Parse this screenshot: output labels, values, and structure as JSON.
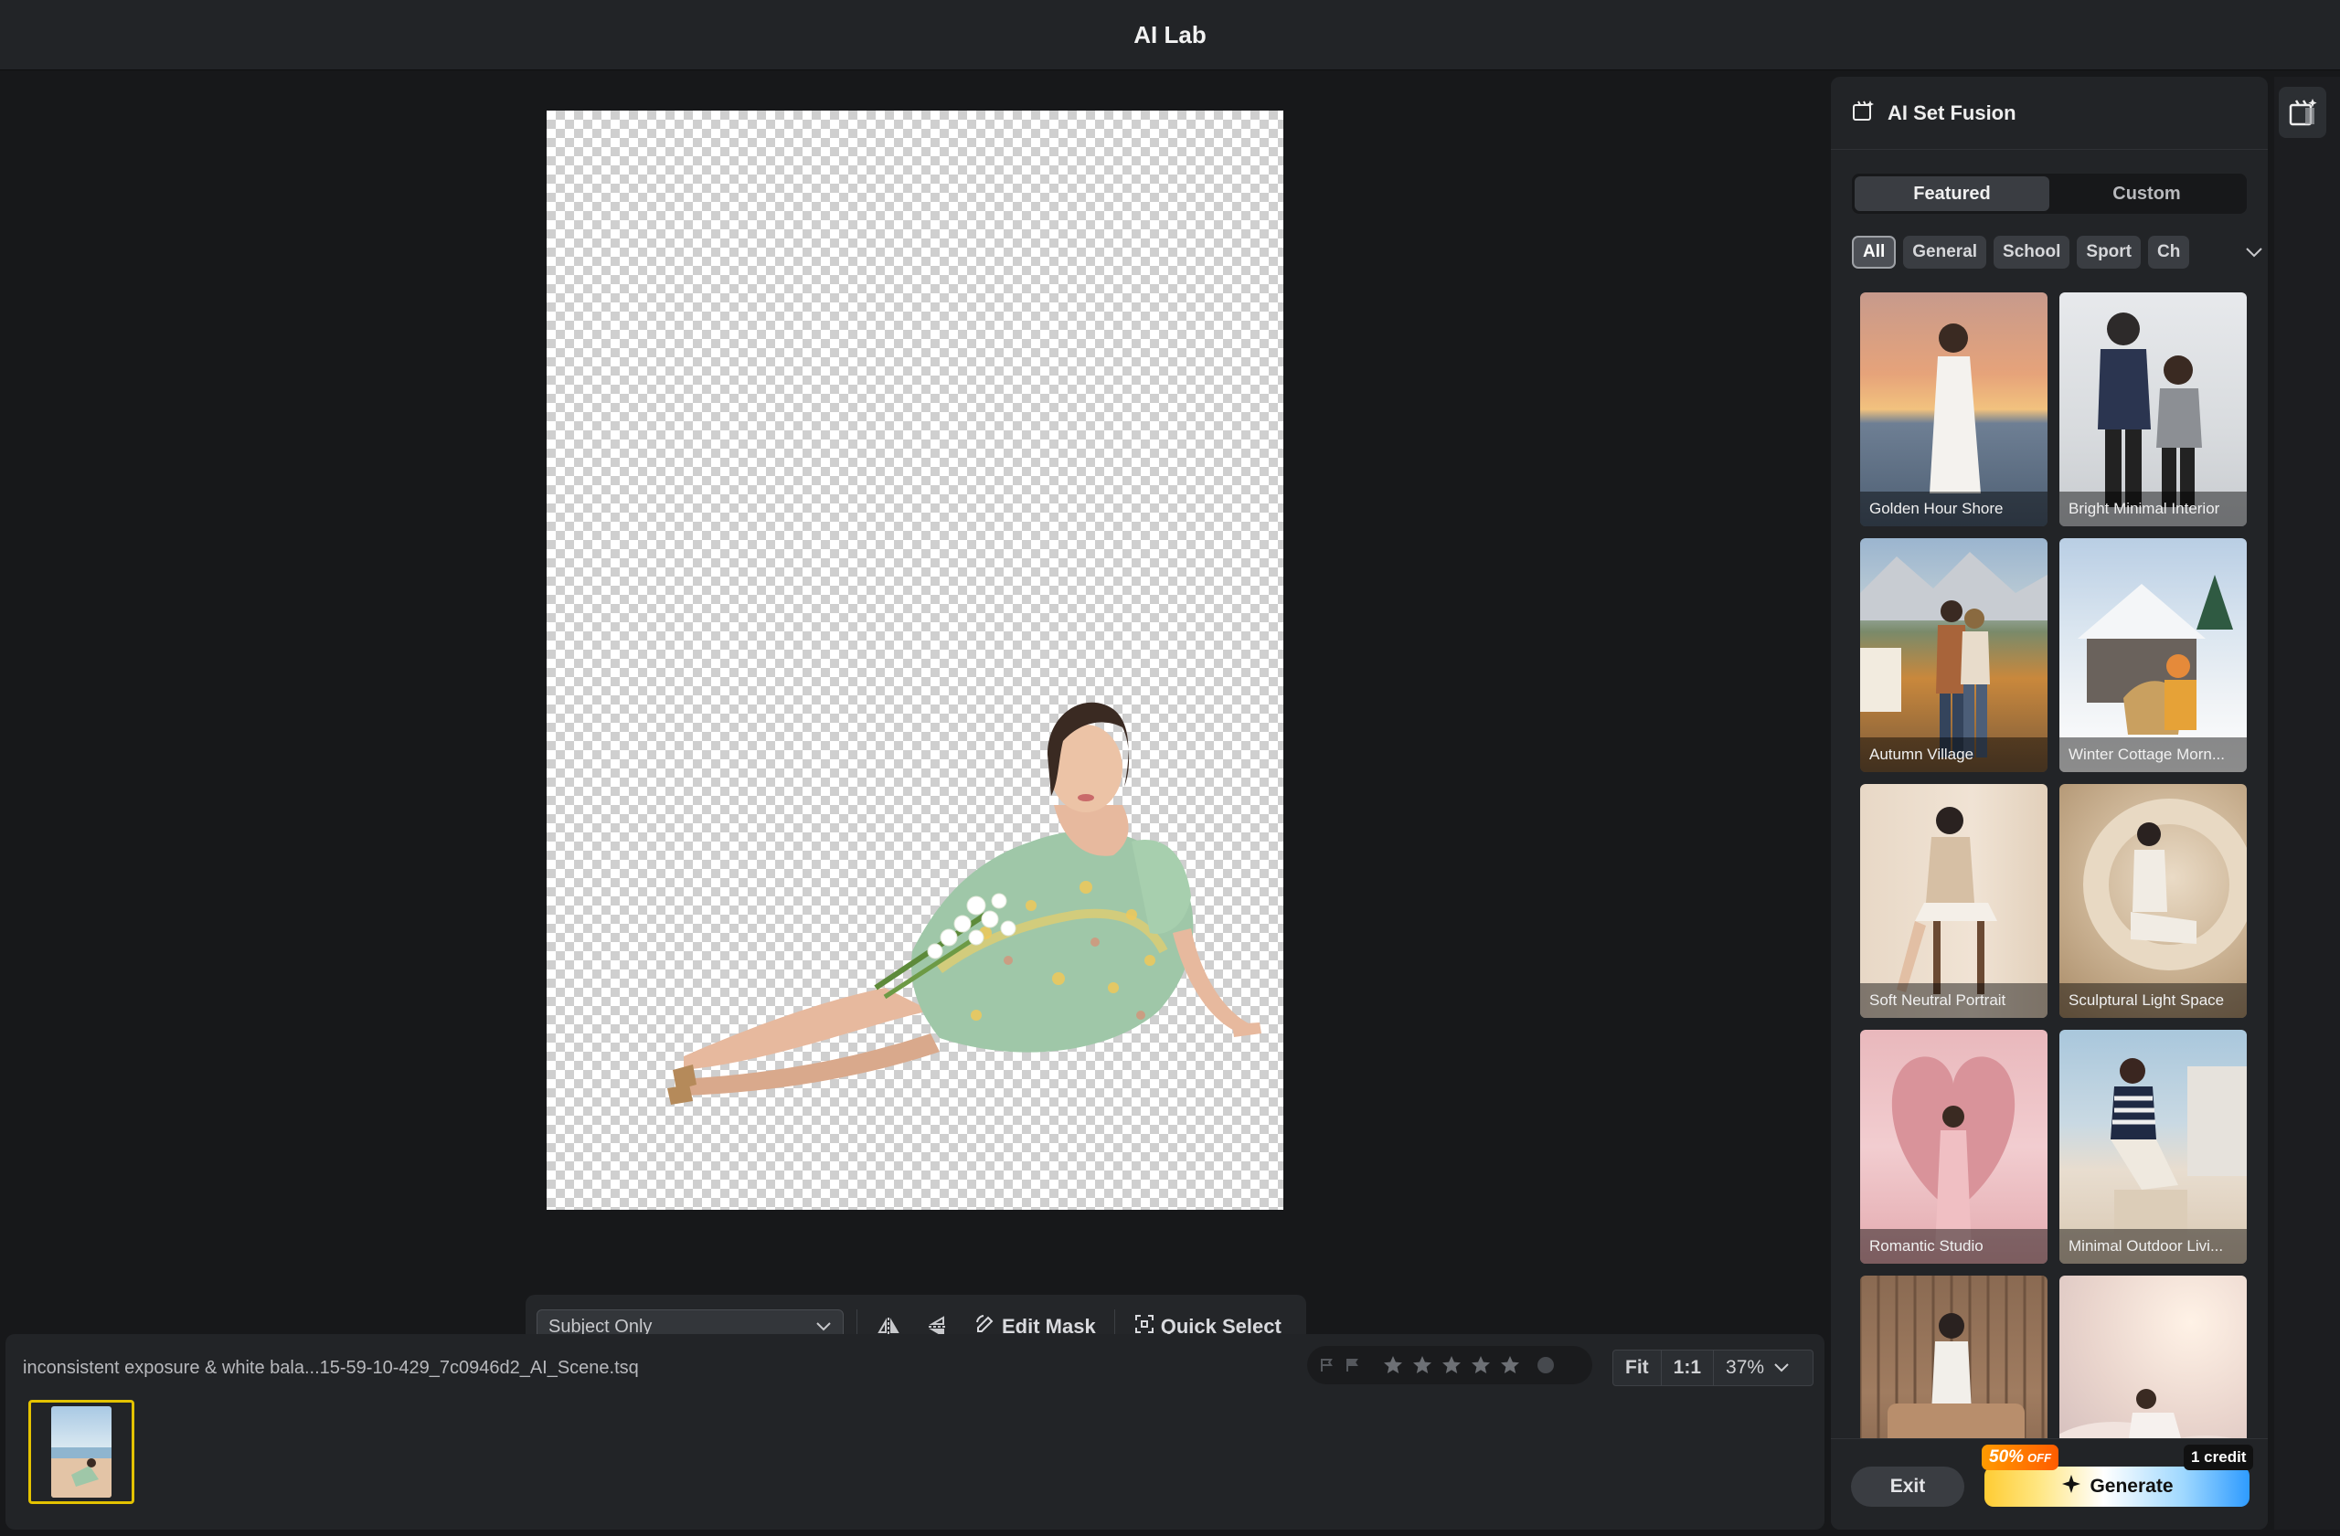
{
  "window": {
    "title": "AI Lab"
  },
  "toolbar": {
    "mask_mode": "Subject Only",
    "edit_mask": "Edit Mask",
    "quick_select": "Quick Select"
  },
  "filmstrip": {
    "filename": "inconsistent exposure & white bala...15-59-10-429_7c0946d2_AI_Scene.tsq",
    "rating": 0,
    "zoom": {
      "fit": "Fit",
      "one_to_one": "1:1",
      "level": "37%"
    }
  },
  "panel": {
    "title": "AI Set Fusion",
    "tabs": [
      {
        "label": "Featured",
        "active": true
      },
      {
        "label": "Custom",
        "active": false
      }
    ],
    "chips": [
      {
        "label": "All",
        "active": true
      },
      {
        "label": "General",
        "active": false
      },
      {
        "label": "School",
        "active": false
      },
      {
        "label": "Sport",
        "active": false
      },
      {
        "label": "Ch",
        "active": false
      }
    ],
    "scenes": [
      {
        "label": "Golden Hour Shore"
      },
      {
        "label": "Bright Minimal Interior"
      },
      {
        "label": "Autumn Village"
      },
      {
        "label": "Winter Cottage Morn..."
      },
      {
        "label": "Soft Neutral Portrait"
      },
      {
        "label": "Sculptural Light Space"
      },
      {
        "label": "Romantic Studio"
      },
      {
        "label": "Minimal Outdoor Livi..."
      },
      {
        "label": ""
      },
      {
        "label": ""
      }
    ],
    "footer": {
      "exit": "Exit",
      "generate": "Generate",
      "promo": "50%",
      "promo_suffix": "OFF",
      "credit": "1 credit"
    }
  },
  "colors": {
    "accent_yellow": "#e3c200",
    "panel_bg": "#222427",
    "app_bg": "#17181a"
  }
}
